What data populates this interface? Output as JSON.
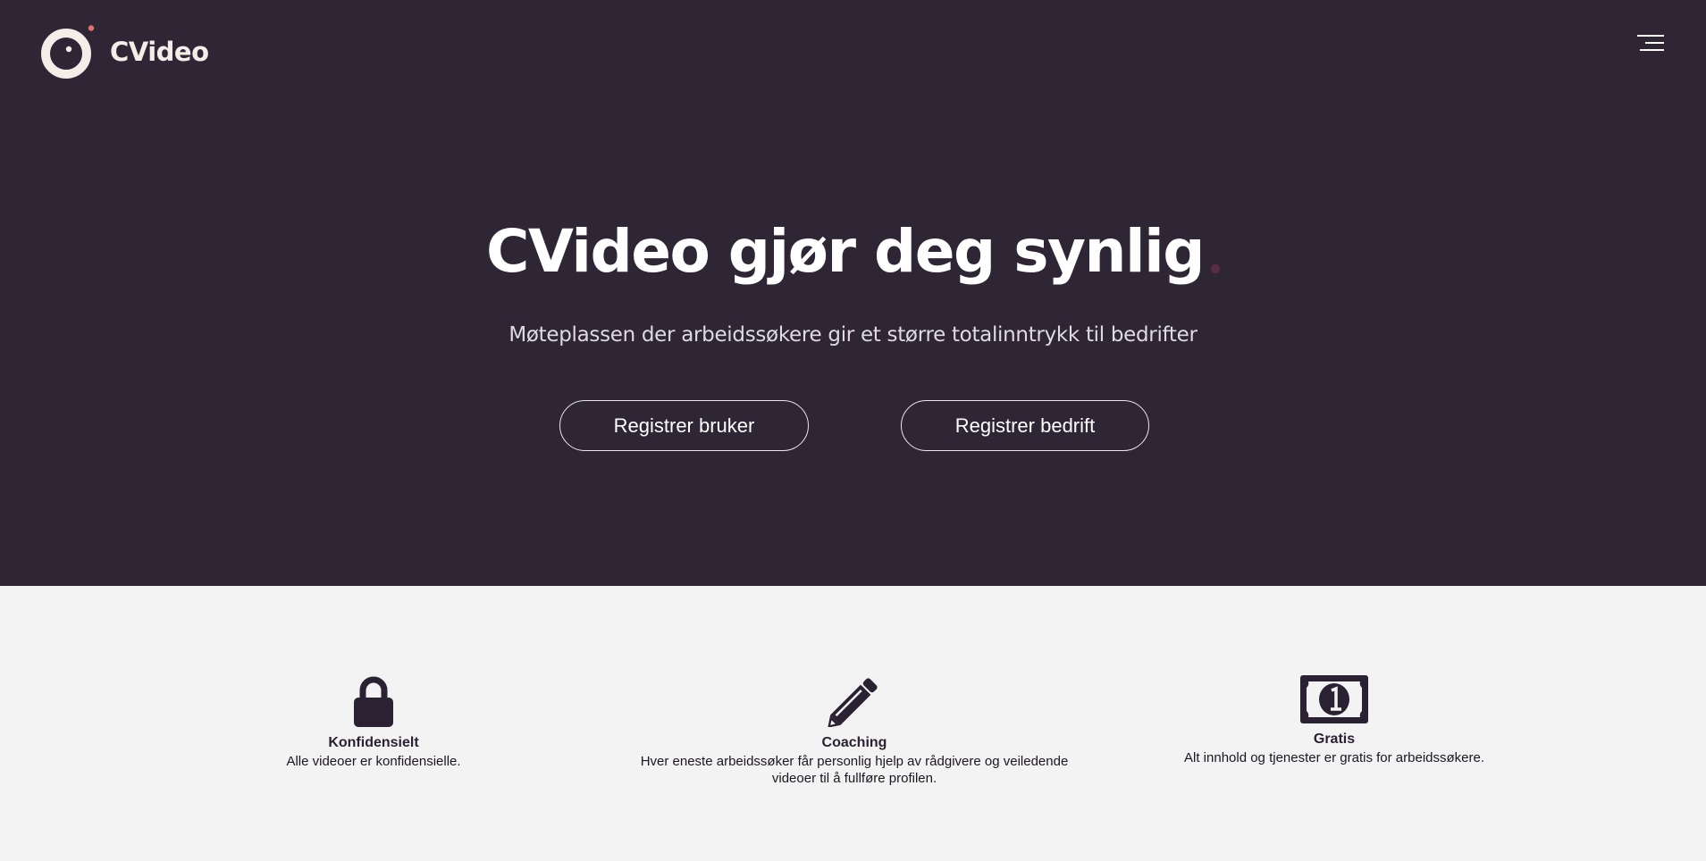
{
  "header": {
    "logo_text": "CVideo",
    "menu_icon": "hamburger-menu-icon"
  },
  "hero": {
    "title": "CVideo gjør deg synlig",
    "subtitle": "Møteplassen der arbeidssøkere gir et større totalinntrykk til bedrifter",
    "buttons": {
      "register_user": "Registrer bruker",
      "register_company": "Registrer bedrift"
    }
  },
  "features": [
    {
      "icon": "lock-icon",
      "title": "Konfidensielt",
      "description": "Alle videoer er konfidensielle."
    },
    {
      "icon": "pencil-icon",
      "title": "Coaching",
      "description": "Hver eneste arbeidssøker får personlig hjelp av rådgivere og veiledende videoer til å fullføre profilen."
    },
    {
      "icon": "banknote-icon",
      "title": "Gratis",
      "description": "Alt innhold og tjenester er gratis for arbeidssøkere."
    }
  ],
  "colors": {
    "hero_background": "#2e2535",
    "feature_background": "#f3f3f3",
    "logo_accent": "#e0736c",
    "title_dot": "#5a2f45",
    "icon_color": "#2a2233"
  }
}
